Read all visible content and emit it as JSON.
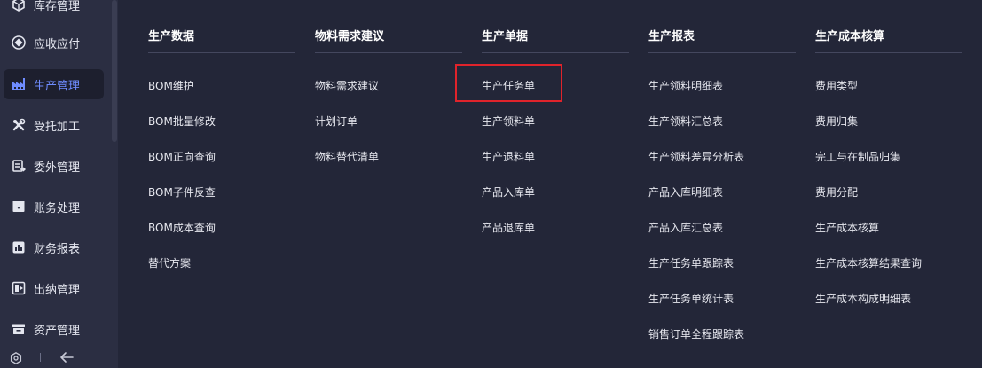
{
  "sidebar": {
    "items": [
      {
        "label": "库存管理",
        "icon": "cube-icon"
      },
      {
        "label": "应收应付",
        "icon": "diamond-icon"
      },
      {
        "label": "生产管理",
        "icon": "factory-icon",
        "active": true
      },
      {
        "label": "受托加工",
        "icon": "tools-icon"
      },
      {
        "label": "委外管理",
        "icon": "outsource-icon"
      },
      {
        "label": "账务处理",
        "icon": "ledger-icon"
      },
      {
        "label": "财务报表",
        "icon": "report-icon"
      },
      {
        "label": "出纳管理",
        "icon": "cashier-icon"
      },
      {
        "label": "资产管理",
        "icon": "asset-icon"
      }
    ],
    "active_color": "#6f8cff"
  },
  "menu": {
    "columns": [
      {
        "title": "生产数据",
        "items": [
          "BOM维护",
          "BOM批量修改",
          "BOM正向查询",
          "BOM子件反查",
          "BOM成本查询",
          "替代方案"
        ]
      },
      {
        "title": "物料需求建议",
        "items": [
          "物料需求建议",
          "计划订单",
          "物料替代清单"
        ]
      },
      {
        "title": "生产单据",
        "items": [
          "生产任务单",
          "生产领料单",
          "生产退料单",
          "产品入库单",
          "产品退库单"
        ]
      },
      {
        "title": "生产报表",
        "items": [
          "生产领料明细表",
          "生产领料汇总表",
          "生产领料差异分析表",
          "产品入库明细表",
          "产品入库汇总表",
          "生产任务单跟踪表",
          "生产任务单统计表",
          "销售订单全程跟踪表"
        ]
      },
      {
        "title": "生产成本核算",
        "items": [
          "费用类型",
          "费用归集",
          "完工与在制品归集",
          "费用分配",
          "生产成本核算",
          "生产成本核算结果查询",
          "生产成本构成明细表"
        ]
      }
    ],
    "highlighted_item": "生产任务单",
    "highlight_color": "#e0232b"
  }
}
